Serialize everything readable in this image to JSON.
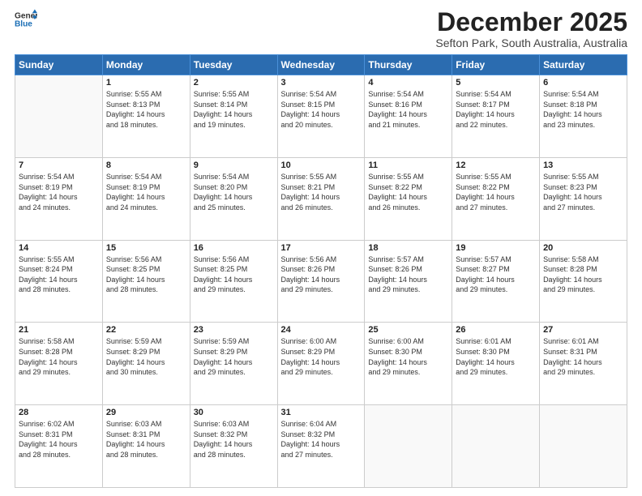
{
  "header": {
    "logo_line1": "General",
    "logo_line2": "Blue",
    "month": "December 2025",
    "location": "Sefton Park, South Australia, Australia"
  },
  "weekdays": [
    "Sunday",
    "Monday",
    "Tuesday",
    "Wednesday",
    "Thursday",
    "Friday",
    "Saturday"
  ],
  "weeks": [
    [
      {
        "day": "",
        "info": ""
      },
      {
        "day": "1",
        "info": "Sunrise: 5:55 AM\nSunset: 8:13 PM\nDaylight: 14 hours\nand 18 minutes."
      },
      {
        "day": "2",
        "info": "Sunrise: 5:55 AM\nSunset: 8:14 PM\nDaylight: 14 hours\nand 19 minutes."
      },
      {
        "day": "3",
        "info": "Sunrise: 5:54 AM\nSunset: 8:15 PM\nDaylight: 14 hours\nand 20 minutes."
      },
      {
        "day": "4",
        "info": "Sunrise: 5:54 AM\nSunset: 8:16 PM\nDaylight: 14 hours\nand 21 minutes."
      },
      {
        "day": "5",
        "info": "Sunrise: 5:54 AM\nSunset: 8:17 PM\nDaylight: 14 hours\nand 22 minutes."
      },
      {
        "day": "6",
        "info": "Sunrise: 5:54 AM\nSunset: 8:18 PM\nDaylight: 14 hours\nand 23 minutes."
      }
    ],
    [
      {
        "day": "7",
        "info": "Sunrise: 5:54 AM\nSunset: 8:19 PM\nDaylight: 14 hours\nand 24 minutes."
      },
      {
        "day": "8",
        "info": "Sunrise: 5:54 AM\nSunset: 8:19 PM\nDaylight: 14 hours\nand 24 minutes."
      },
      {
        "day": "9",
        "info": "Sunrise: 5:54 AM\nSunset: 8:20 PM\nDaylight: 14 hours\nand 25 minutes."
      },
      {
        "day": "10",
        "info": "Sunrise: 5:55 AM\nSunset: 8:21 PM\nDaylight: 14 hours\nand 26 minutes."
      },
      {
        "day": "11",
        "info": "Sunrise: 5:55 AM\nSunset: 8:22 PM\nDaylight: 14 hours\nand 26 minutes."
      },
      {
        "day": "12",
        "info": "Sunrise: 5:55 AM\nSunset: 8:22 PM\nDaylight: 14 hours\nand 27 minutes."
      },
      {
        "day": "13",
        "info": "Sunrise: 5:55 AM\nSunset: 8:23 PM\nDaylight: 14 hours\nand 27 minutes."
      }
    ],
    [
      {
        "day": "14",
        "info": "Sunrise: 5:55 AM\nSunset: 8:24 PM\nDaylight: 14 hours\nand 28 minutes."
      },
      {
        "day": "15",
        "info": "Sunrise: 5:56 AM\nSunset: 8:25 PM\nDaylight: 14 hours\nand 28 minutes."
      },
      {
        "day": "16",
        "info": "Sunrise: 5:56 AM\nSunset: 8:25 PM\nDaylight: 14 hours\nand 29 minutes."
      },
      {
        "day": "17",
        "info": "Sunrise: 5:56 AM\nSunset: 8:26 PM\nDaylight: 14 hours\nand 29 minutes."
      },
      {
        "day": "18",
        "info": "Sunrise: 5:57 AM\nSunset: 8:26 PM\nDaylight: 14 hours\nand 29 minutes."
      },
      {
        "day": "19",
        "info": "Sunrise: 5:57 AM\nSunset: 8:27 PM\nDaylight: 14 hours\nand 29 minutes."
      },
      {
        "day": "20",
        "info": "Sunrise: 5:58 AM\nSunset: 8:28 PM\nDaylight: 14 hours\nand 29 minutes."
      }
    ],
    [
      {
        "day": "21",
        "info": "Sunrise: 5:58 AM\nSunset: 8:28 PM\nDaylight: 14 hours\nand 29 minutes."
      },
      {
        "day": "22",
        "info": "Sunrise: 5:59 AM\nSunset: 8:29 PM\nDaylight: 14 hours\nand 30 minutes."
      },
      {
        "day": "23",
        "info": "Sunrise: 5:59 AM\nSunset: 8:29 PM\nDaylight: 14 hours\nand 29 minutes."
      },
      {
        "day": "24",
        "info": "Sunrise: 6:00 AM\nSunset: 8:29 PM\nDaylight: 14 hours\nand 29 minutes."
      },
      {
        "day": "25",
        "info": "Sunrise: 6:00 AM\nSunset: 8:30 PM\nDaylight: 14 hours\nand 29 minutes."
      },
      {
        "day": "26",
        "info": "Sunrise: 6:01 AM\nSunset: 8:30 PM\nDaylight: 14 hours\nand 29 minutes."
      },
      {
        "day": "27",
        "info": "Sunrise: 6:01 AM\nSunset: 8:31 PM\nDaylight: 14 hours\nand 29 minutes."
      }
    ],
    [
      {
        "day": "28",
        "info": "Sunrise: 6:02 AM\nSunset: 8:31 PM\nDaylight: 14 hours\nand 28 minutes."
      },
      {
        "day": "29",
        "info": "Sunrise: 6:03 AM\nSunset: 8:31 PM\nDaylight: 14 hours\nand 28 minutes."
      },
      {
        "day": "30",
        "info": "Sunrise: 6:03 AM\nSunset: 8:32 PM\nDaylight: 14 hours\nand 28 minutes."
      },
      {
        "day": "31",
        "info": "Sunrise: 6:04 AM\nSunset: 8:32 PM\nDaylight: 14 hours\nand 27 minutes."
      },
      {
        "day": "",
        "info": ""
      },
      {
        "day": "",
        "info": ""
      },
      {
        "day": "",
        "info": ""
      }
    ]
  ]
}
